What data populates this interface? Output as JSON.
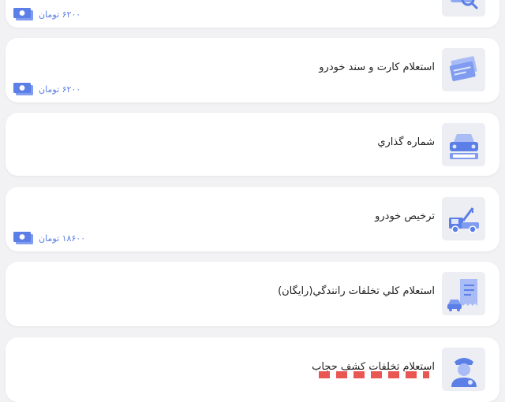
{
  "accent_color": "#5b7fe6",
  "services": [
    {
      "title": "",
      "price": "۶۲۰۰ تومان",
      "icon": "search-icon"
    },
    {
      "title": "استعلام کارت و سند خودرو",
      "price": "۶۲۰۰ تومان",
      "icon": "cards-icon"
    },
    {
      "title": "شماره گذاري",
      "price": "",
      "icon": "car-front-icon"
    },
    {
      "title": "ترخيص خودرو",
      "price": "۱۸۶۰۰ تومان",
      "icon": "tow-truck-icon"
    },
    {
      "title": "استعلام کلي تخلفات رانندگي(رايگان)",
      "price": "",
      "icon": "receipt-car-icon"
    },
    {
      "title": "استعلام تخلفات کشف حجاب",
      "price": "",
      "icon": "police-officer-icon"
    }
  ]
}
